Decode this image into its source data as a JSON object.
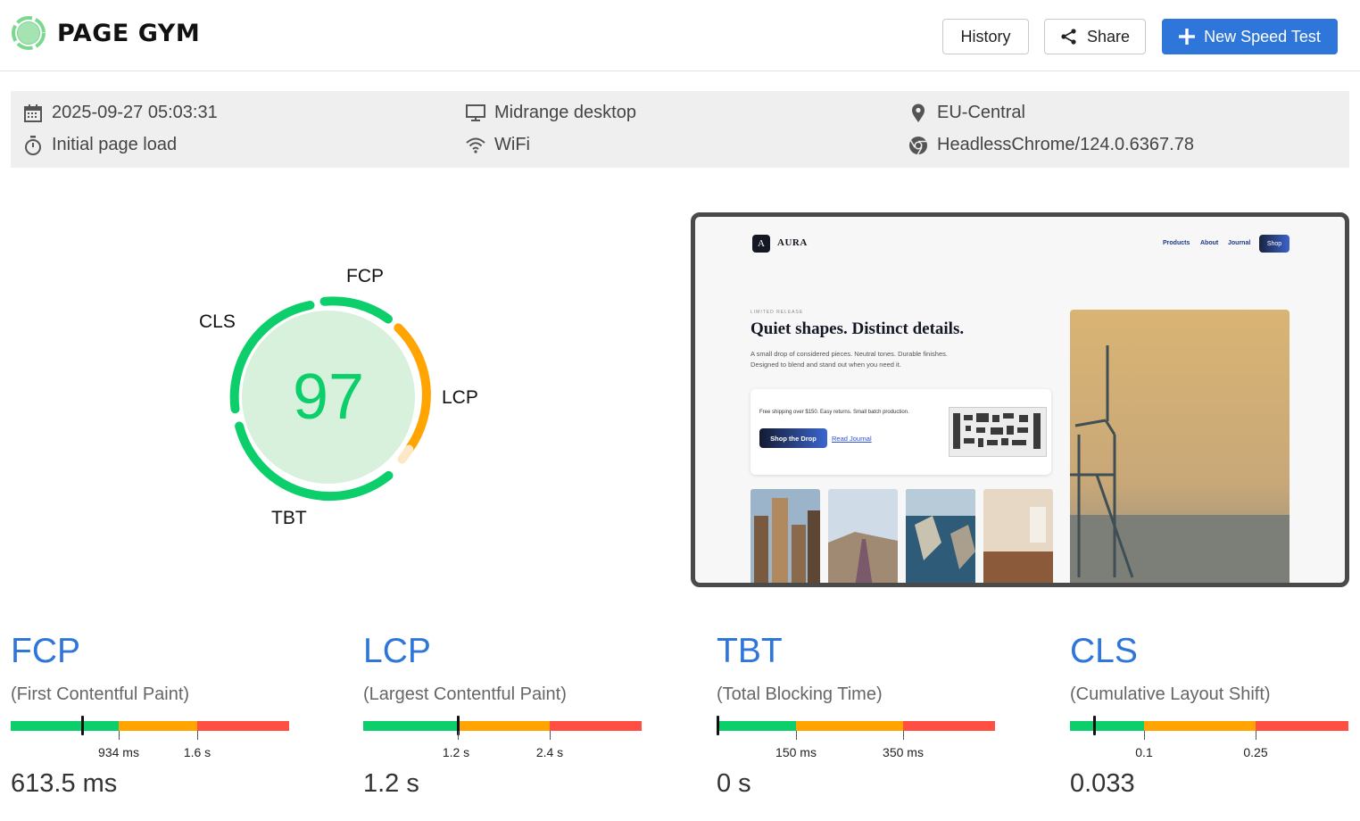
{
  "header": {
    "brand": "PAGE GYM",
    "history_label": "History",
    "share_label": "Share",
    "new_test_label": "New Speed Test",
    "accent_color": "#2f76db"
  },
  "test_info": {
    "datetime": "2025-09-27 05:03:31",
    "page_load": "Initial page load",
    "device": "Midrange desktop",
    "network": "WiFi",
    "location": "EU-Central",
    "browser": "HeadlessChrome/124.0.6367.78",
    "icons": [
      "calendar-icon",
      "stopwatch-icon",
      "monitor-icon",
      "wifi-icon",
      "location-pin-icon",
      "chrome-icon"
    ]
  },
  "score": {
    "value": "97",
    "labels": {
      "fcp": "FCP",
      "lcp": "LCP",
      "tbt": "TBT",
      "cls": "CLS"
    },
    "color_good": "#0cce6b",
    "color_mid": "#ffa400"
  },
  "preview": {
    "brand_initial": "A",
    "brand": "AURA",
    "nav": [
      "Products",
      "About",
      "Journal"
    ],
    "shop_button": "Shop",
    "eyebrow": "LIMITED RELEASE",
    "headline": "Quiet shapes. Distinct details.",
    "subtext": "A small drop of considered pieces. Neutral tones. Durable finishes. Designed to blend and stand out when you need it.",
    "card_text": "Free shipping over $150. Easy returns. Small batch production.",
    "card_button": "Shop the Drop",
    "card_link": "Read Journal"
  },
  "metrics": [
    {
      "abbr": "FCP",
      "full": "(First Contentful Paint)",
      "value": "613.5 ms",
      "ticks": [
        "934 ms",
        "1.6 s"
      ],
      "marker_fraction": 0.257
    },
    {
      "abbr": "LCP",
      "full": "(Largest Contentful Paint)",
      "value": "1.2 s",
      "ticks": [
        "1.2 s",
        "2.4 s"
      ],
      "marker_fraction": 0.34
    },
    {
      "abbr": "TBT",
      "full": "(Total Blocking Time)",
      "value": "0 s",
      "ticks": [
        "150 ms",
        "350 ms"
      ],
      "marker_fraction": 0.0
    },
    {
      "abbr": "CLS",
      "full": "(Cumulative Layout Shift)",
      "value": "0.033",
      "ticks": [
        "0.1",
        "0.25"
      ],
      "marker_fraction": 0.085
    }
  ]
}
